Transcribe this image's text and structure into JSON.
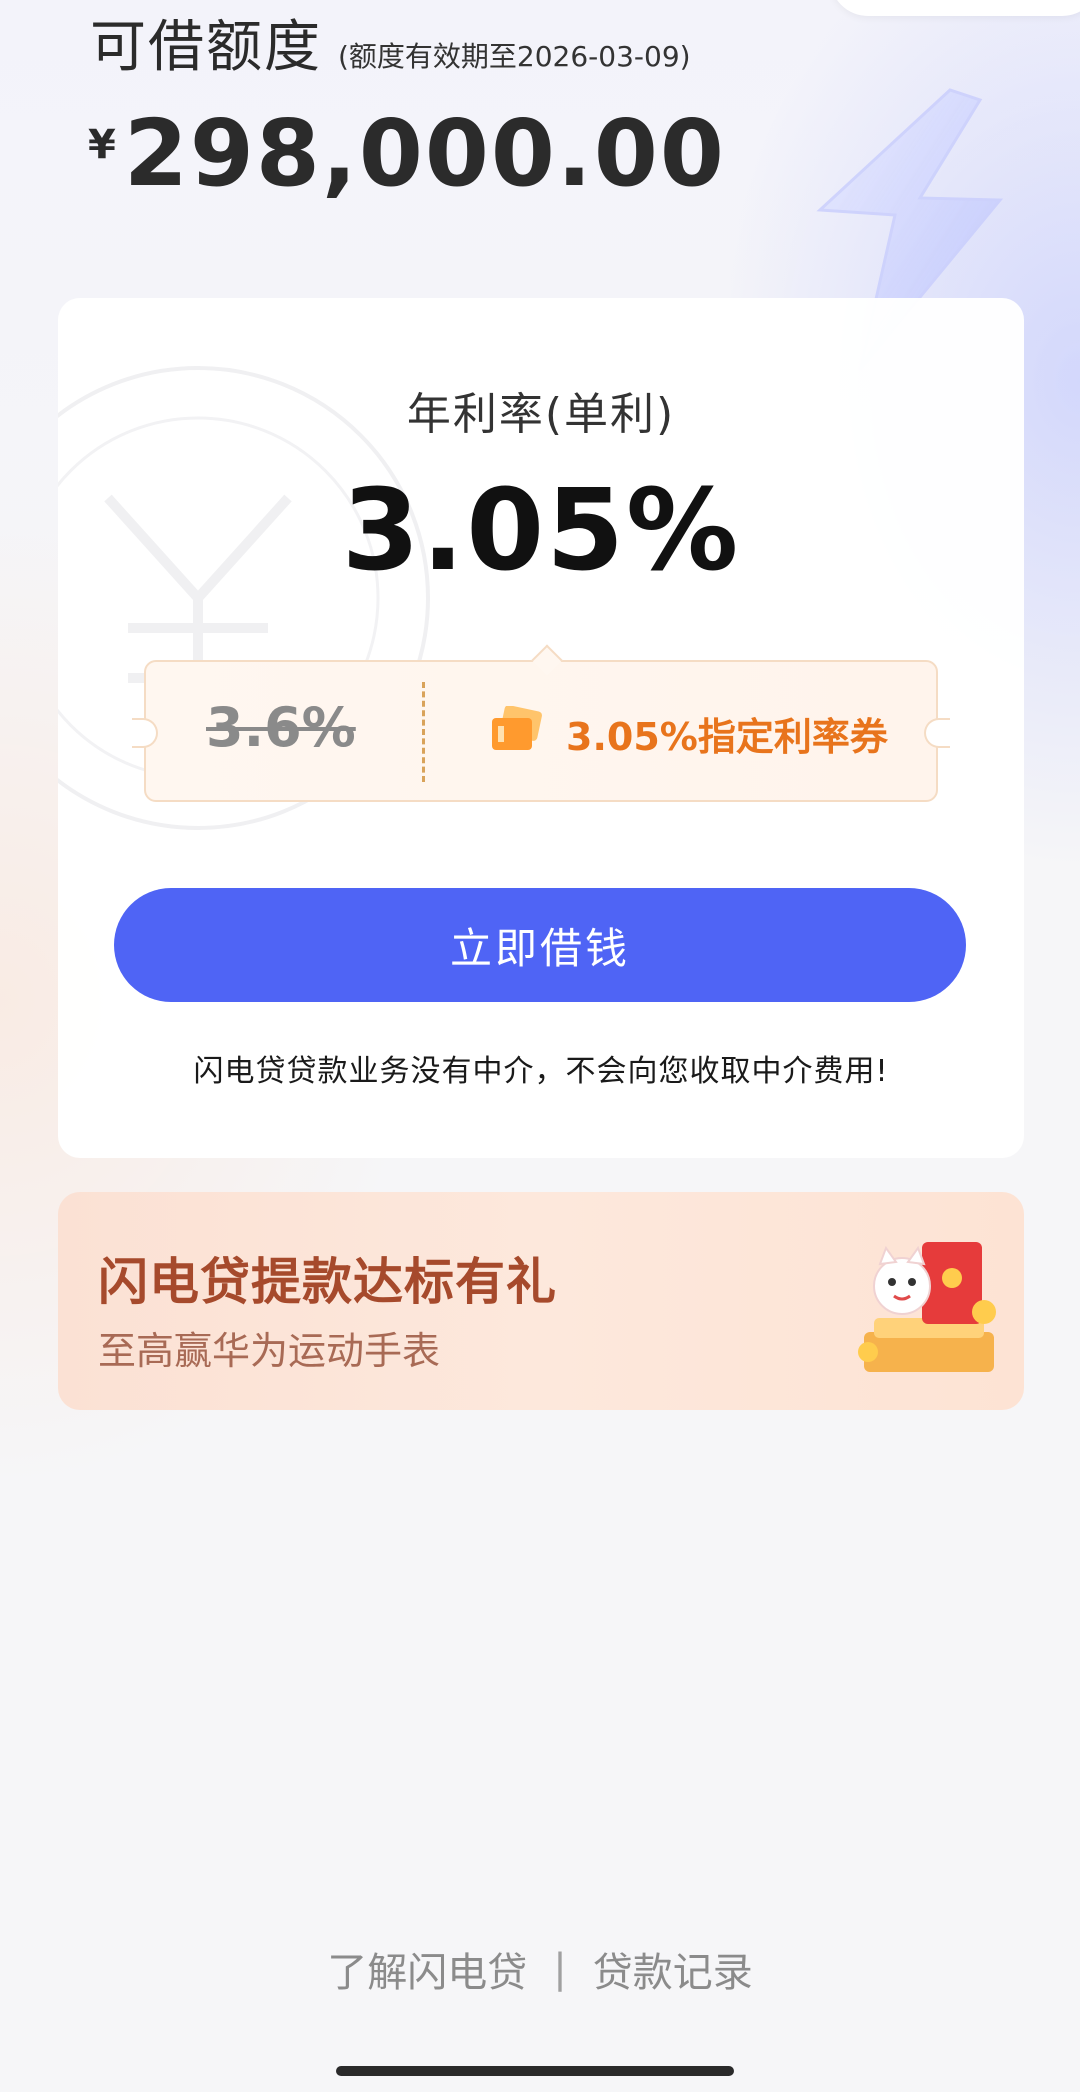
{
  "header": {
    "title": "可借额度",
    "validity": "(额度有效期至2026-03-09)",
    "currency_symbol": "¥",
    "amount": "298,000.00"
  },
  "rate_card": {
    "label": "年利率(单利)",
    "value": "3.05%",
    "coupon": {
      "original_rate": "3.6%",
      "coupon_label": "3.05%指定利率券",
      "icon": "ticket-icon"
    },
    "borrow_button": "立即借钱",
    "notice": "闪电贷贷款业务没有中介，不会向您收取中介费用!"
  },
  "promo": {
    "title": "闪电贷提款达标有礼",
    "subtitle": "至高赢华为运动手表"
  },
  "footer": {
    "about_link": "了解闪电贷",
    "separator": "|",
    "records_link": "贷款记录"
  },
  "colors": {
    "primary_button": "#4f64f5",
    "coupon_accent": "#e8741c",
    "promo_title": "#a64a2c"
  }
}
